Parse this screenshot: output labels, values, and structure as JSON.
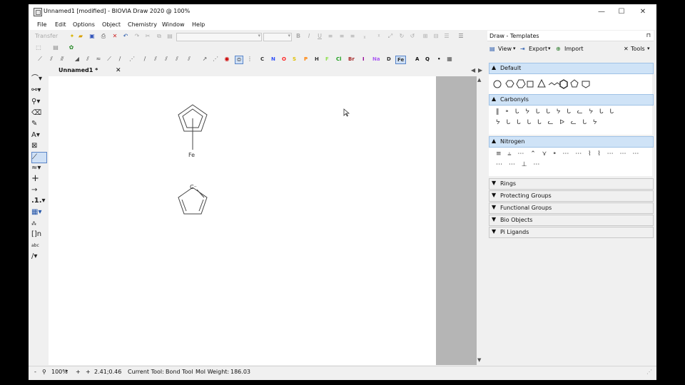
{
  "window": {
    "title": "Unnamed1 [modified] - BIOVIA Draw 2020  @ 100%",
    "min": "—",
    "max": "☐",
    "close": "✕"
  },
  "menu": [
    "File",
    "Edit",
    "Options",
    "Object",
    "Chemistry",
    "Window",
    "Help"
  ],
  "toolbar": {
    "transfer_label": "Transfer"
  },
  "elements": [
    "C",
    "N",
    "O",
    "S",
    "P",
    "H",
    "F",
    "Cl",
    "Br",
    "I",
    "Na",
    "D",
    "Fe"
  ],
  "element_colors": {
    "C": "#333333",
    "N": "#3050f8",
    "O": "#ff2020",
    "S": "#e0c000",
    "P": "#ff8000",
    "H": "#333333",
    "F": "#90e050",
    "Cl": "#1fa01f",
    "Br": "#a62929",
    "I": "#940094",
    "Na": "#ab5cf2",
    "D": "#333333",
    "Fe": "#333333"
  },
  "selected_element": "Fe",
  "extra_labels": {
    "a": "A",
    "q": "Q",
    "dot": "•"
  },
  "document_tab": {
    "label": "Unnamed1 *",
    "close": "✕"
  },
  "structures": {
    "iron_label": "Fe",
    "anion_label": "C⁻"
  },
  "status": {
    "zoom": "100%",
    "minus": "-",
    "plus": "+",
    "coords": "2.41;0.46",
    "current_tool_label": "Current Tool:",
    "current_tool": "Bond Tool",
    "mol_weight_label": "Mol Weight:",
    "mol_weight": "186.03"
  },
  "panel": {
    "title": "Draw - Templates",
    "pin": "⊓",
    "view": "View",
    "export": "Export",
    "import": "Import",
    "tools": "Tools",
    "sections": [
      {
        "label": "Default",
        "expanded": true
      },
      {
        "label": "Carbonyls",
        "expanded": true
      },
      {
        "label": "Nitrogen",
        "expanded": true
      },
      {
        "label": "Rings",
        "expanded": false
      },
      {
        "label": "Protecting Groups",
        "expanded": false
      },
      {
        "label": "Functional Groups",
        "expanded": false
      },
      {
        "label": "Bio Objects",
        "expanded": false
      },
      {
        "label": "Pi Ligands",
        "expanded": false
      }
    ],
    "icons": {
      "default": [
        "cyclopropane-icon",
        "cyclobutane-icon",
        "cyclopentane-icon",
        "cyclohexane-icon",
        "cycloheptane-icon",
        "chair-icon",
        "benzene-icon",
        "cyclopentadiene-icon",
        "cyclooctane-icon"
      ],
      "carbonyls": [
        "ketone-template-icon",
        "aldehyde-template-icon",
        "ester-template-icon",
        "acid-template-icon",
        "amide-template-icon"
      ],
      "nitrogen": [
        "amine-template-icon",
        "imine-template-icon",
        "nitrile-template-icon",
        "hydrazine-template-icon"
      ]
    }
  },
  "left_tools": [
    "lasso-select-icon",
    "chain-tool-icon",
    "zoom-icon",
    "eraser-icon",
    "atom-edit-icon",
    "text-tool-icon",
    "template-tool-icon",
    "bond-tool-icon",
    "wavy-bond-icon",
    "charge-plus-icon",
    "arrow-tool-icon",
    "atom-number-icon",
    "sequence-tool-icon",
    "ring-label-icon",
    "bracket-tool-icon",
    "abc-label-icon",
    "line-tool-icon"
  ]
}
